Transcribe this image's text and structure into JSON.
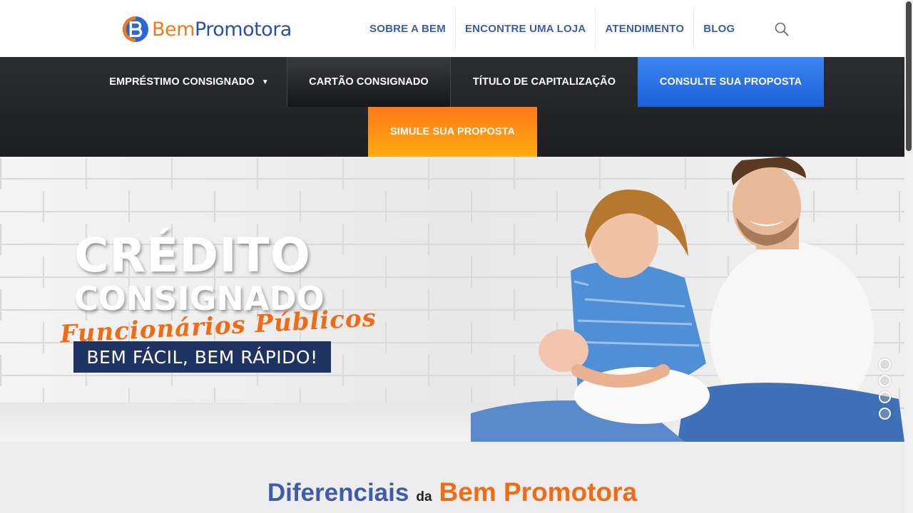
{
  "brand": {
    "name_part1": "Bem",
    "name_part2": "Promotora",
    "logo_letter": "B",
    "color_blue": "#2a4fa8",
    "color_orange": "#f07a1a"
  },
  "top_nav": {
    "items": [
      {
        "label": "SOBRE A BEM"
      },
      {
        "label": "ENCONTRE UMA LOJA"
      },
      {
        "label": "ATENDIMENTO"
      },
      {
        "label": "BLOG"
      }
    ],
    "search_icon": "search-icon"
  },
  "main_nav": {
    "emprestimo": "EMPRÉSTIMO CONSIGNADO",
    "emprestimo_caret": "▼",
    "cartao": "CARTÃO CONSIGNADO",
    "titulo": "TÍTULO DE CAPITALIZAÇÃO",
    "consulte": "CONSULTE SUA PROPOSTA",
    "simule": "SIMULE SUA PROPOSTA",
    "consulte_color": "#2f74e6",
    "simule_color": "#ff9410"
  },
  "hero": {
    "title_line1": "CRÉDITO",
    "title_line2": "CONSIGNADO",
    "script_text": "Funcionários Públicos",
    "tagline": "BEM FÁCIL, BEM RÁPIDO!",
    "slides_total": 4,
    "active_slide": 1
  },
  "diferenciais": {
    "word1": "Diferenciais",
    "word2": "da",
    "word3": "Bem Promotora"
  }
}
